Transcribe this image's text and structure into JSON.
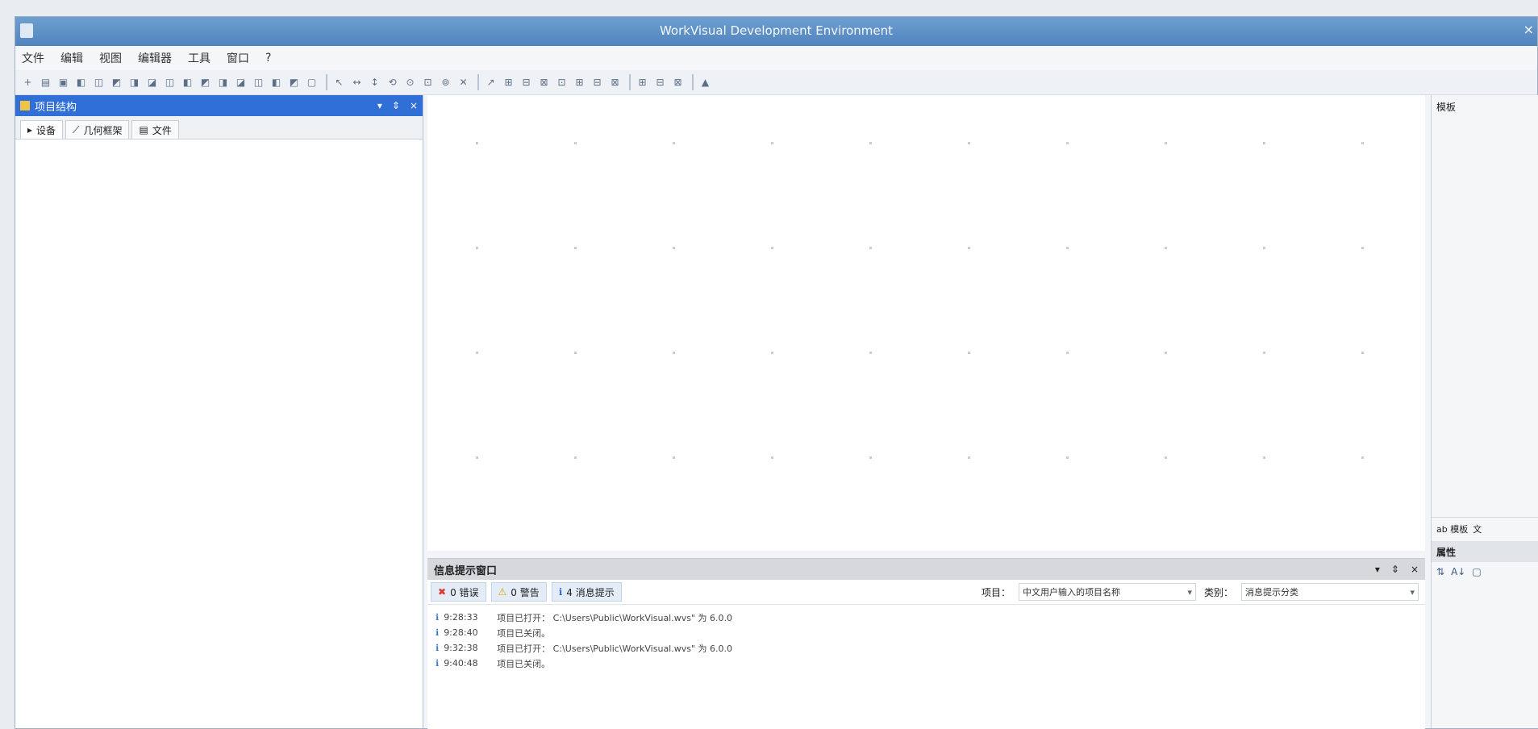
{
  "window": {
    "title": "WorkVisual Development Environment",
    "close_glyph": "×"
  },
  "menu": [
    "文件",
    "编辑",
    "视图",
    "编辑器",
    "工具",
    "窗口",
    "?"
  ],
  "toolbar_groups": [
    [
      "+",
      "▤",
      "▣",
      "◧",
      "◫",
      "◩",
      "◨",
      "◪",
      "◫",
      "◧",
      "◩",
      "◨",
      "◪",
      "◫",
      "◧",
      "◩",
      "▢"
    ],
    [
      "↖",
      "↔",
      "↕",
      "⟲",
      "⊙",
      "⊡",
      "⊚",
      "✕"
    ],
    [
      "↗",
      "⊞",
      "⊟",
      "⊠",
      "⊡",
      "⊞",
      "⊟",
      "⊠"
    ],
    [
      "⊞",
      "⊟",
      "⊠"
    ],
    [
      "▲"
    ]
  ],
  "left_panel": {
    "title": "项目结构",
    "header_buttons": [
      "▾",
      "⇕",
      "×"
    ],
    "tabs": [
      {
        "icon": "▸",
        "label": "设备"
      },
      {
        "icon": "⟋",
        "label": "几何框架"
      },
      {
        "icon": "▤",
        "label": "文件"
      }
    ]
  },
  "right_panel": {
    "title": "模板",
    "tabs": [
      "ab 模板",
      "文"
    ],
    "properties_title": "属性",
    "property_tools": [
      "⇅",
      "A↓",
      "▢"
    ]
  },
  "bottom_panel": {
    "title": "信息提示窗口",
    "header_buttons": [
      "▾",
      "⇕",
      "×"
    ],
    "filters": [
      {
        "icon": "✖",
        "label": "0 错误"
      },
      {
        "icon": "⚠",
        "label": "0 警告"
      },
      {
        "icon": "ℹ",
        "label": "4 消息提示"
      }
    ],
    "filter_label_1": "项目：",
    "filter_value_1": "中文用户输入的项目名称",
    "filter_label_2": "类别：",
    "filter_value_2": "消息提示分类",
    "messages": [
      {
        "time": "9:28:33",
        "text": "项目已打开： C:\\Users\\Public\\WorkVisual.wvs\" 为 6.0.0"
      },
      {
        "time": "9:28:40",
        "text": "项目已关闭。"
      },
      {
        "time": "9:32:38",
        "text": "项目已打开： C:\\Users\\Public\\WorkVisual.wvs\" 为 6.0.0"
      },
      {
        "time": "9:40:48",
        "text": "项目已关闭。"
      }
    ]
  }
}
